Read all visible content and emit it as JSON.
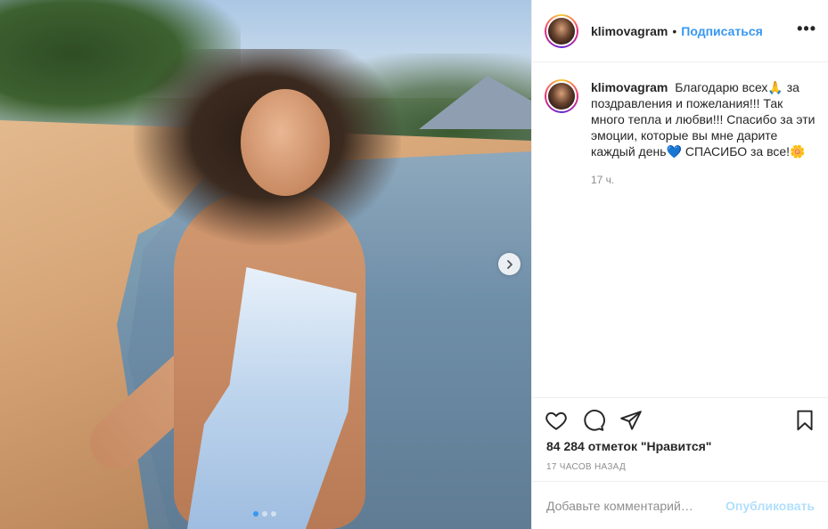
{
  "post": {
    "username": "klimovagram",
    "separator": "•",
    "follow_label": "Подписаться",
    "more_label": "•••",
    "caption_text": "Благодарю всех🙏 за поздравления и пожелания!!! Так много тепла и любви!!! Спасибо за эти эмоции, которые вы мне дарите каждый день💙 СПАСИБО за все!🌼",
    "caption_time": "17 ч.",
    "likes": "84 284 отметок \"Нравится\"",
    "timestamp": "17 часов назад",
    "comment_placeholder": "Добавьте комментарий…",
    "post_label": "Опубликовать"
  },
  "carousel": {
    "slides_count": 3,
    "active_index": 0
  },
  "colors": {
    "accent": "#3897f0",
    "text": "#262626",
    "muted": "#8e8e8e",
    "post_disabled": "#b2dffc",
    "border": "#efefef"
  },
  "icons": {
    "like": "heart-icon",
    "comment": "comment-icon",
    "share": "paper-plane-icon",
    "save": "bookmark-icon",
    "next": "chevron-right-icon"
  }
}
